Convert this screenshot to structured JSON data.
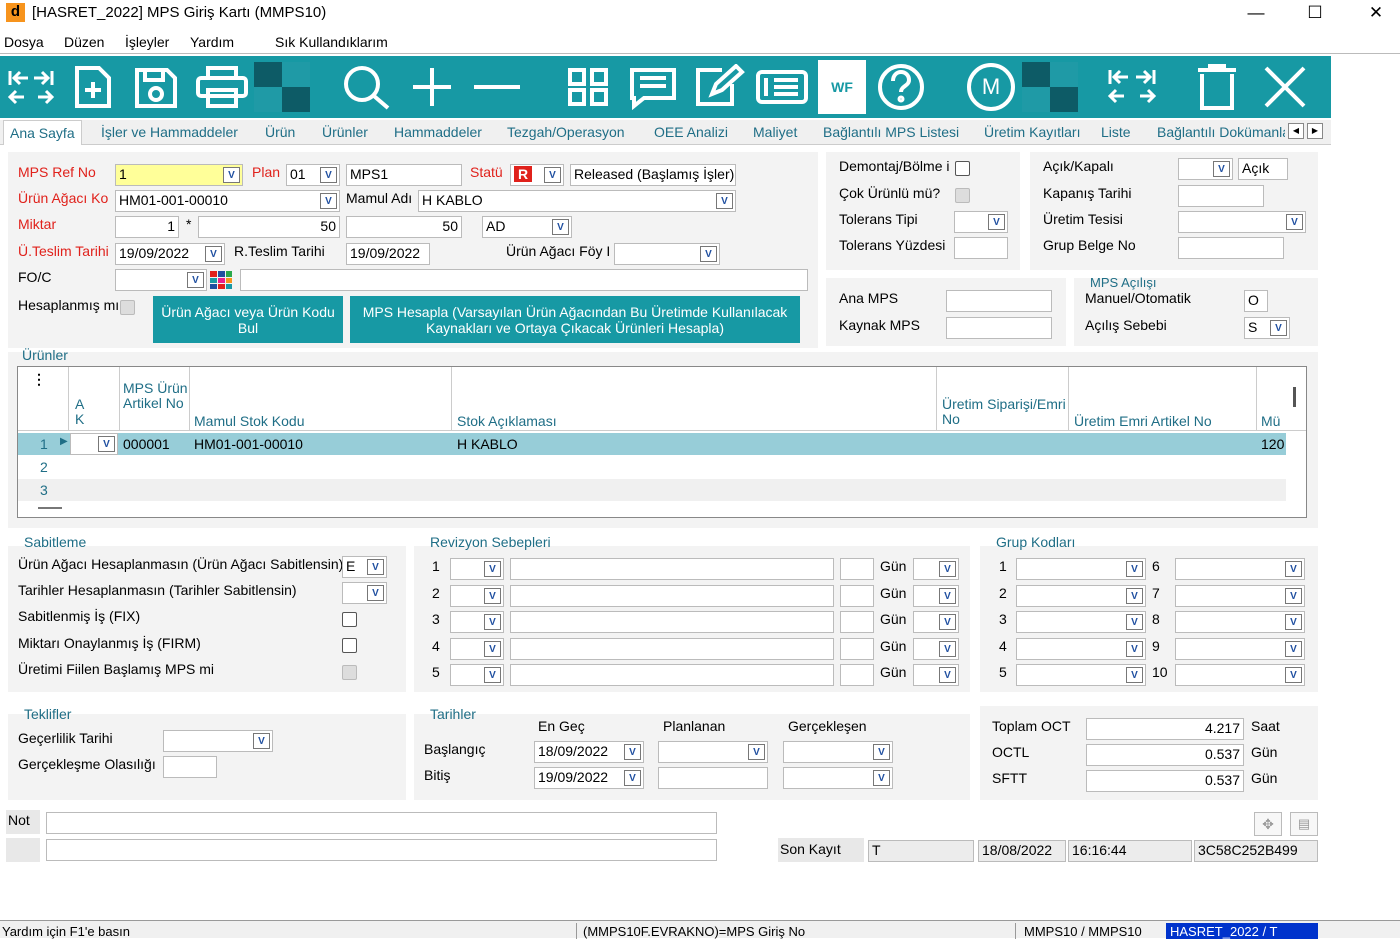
{
  "window": {
    "title": "[HASRET_2022] MPS Giriş Kartı (MMPS10)",
    "icon_letter": "d"
  },
  "menu": [
    "Dosya",
    "Düzen",
    "İşleyler",
    "Yardım",
    "Sık Kullandıklarım"
  ],
  "toolbar": {
    "wf": "WF",
    "m": "M"
  },
  "tabs": [
    "Ana Sayfa",
    "İşler ve Hammaddeler",
    "Ürün",
    "Ürünler",
    "Hammaddeler",
    "Tezgah/Operasyon",
    "OEE Analizi",
    "Maliyet",
    "Bağlantılı MPS Listesi",
    "Üretim Kayıtları",
    "Liste",
    "Bağlantılı Dokümanla"
  ],
  "header": {
    "mps_ref_label": "MPS Ref No",
    "mps_ref_value": "1",
    "plan_label": "Plan",
    "plan_value": "01",
    "plan_name": "MPS1",
    "statu_label": "Statü",
    "statu_code": "R",
    "statu_text": "Released (Başlamış İşler)",
    "urun_agaci_label": "Ürün Ağacı Ko",
    "urun_agaci_value": "HM01-001-00010",
    "mamul_adi_label": "Mamul Adı",
    "mamul_adi_value": "H KABLO",
    "miktar_label": "Miktar",
    "miktar_a": "1",
    "miktar_star": "*",
    "miktar_b": "50",
    "miktar_c": "50",
    "unit": "AD",
    "teslim_label": "Ü.Teslim Tarihi",
    "teslim_value": "19/09/2022",
    "rteslim_label": "R.Teslim Tarihi",
    "rteslim_value": "19/09/2022",
    "foy_label": "Ürün Ağacı Föy I",
    "fo_label": "FO/C",
    "hesap_label": "Hesaplanmış mı",
    "btn_find": "Ürün Ağacı veya Ürün Kodu Bul",
    "btn_calc": "MPS Hesapla (Varsayılan Ürün Ağacından Bu Üretimde Kullanılacak Kaynakları ve Ortaya Çıkacak Ürünleri Hesapla)"
  },
  "right": {
    "demontaj": "Demontaj/Bölme i",
    "cok_urunlu": "Çok Ürünlü mü?",
    "tolerans_tipi": "Tolerans Tipi",
    "tolerans_yuzdesi": "Tolerans Yüzdesi",
    "acik_kapali": "Açık/Kapalı",
    "acik_value": "Açık",
    "kapanis": "Kapanış Tarihi",
    "uretim_tesisi": "Üretim Tesisi",
    "grup_belge": "Grup Belge No",
    "ana_mps": "Ana MPS",
    "kaynak_mps": "Kaynak MPS",
    "mps_acilisi": "MPS Açılışı",
    "manuel": "Manuel/Otomatik",
    "manuel_value": "O",
    "acilis_sebebi": "Açılış Sebebi",
    "acilis_value": "S"
  },
  "urunler": {
    "title": "Ürünler",
    "columns": [
      "A K",
      "MPS Ürün Artikel No",
      "Mamul Stok Kodu",
      "Stok Açıklaması",
      "Üretim Siparişi/Emri No",
      "Üretim Emri Artikel No",
      "Mü"
    ],
    "rows": [
      {
        "n": "1",
        "artikel": "000001",
        "kod": "HM01-001-00010",
        "aciklama": "H KABLO",
        "mu": "120"
      },
      {
        "n": "2"
      },
      {
        "n": "3"
      }
    ]
  },
  "sabitleme": {
    "title": "Sabitleme",
    "l1": "Ürün Ağacı Hesaplanmasın (Ürün Ağacı Sabitlensin)",
    "l1v": "E",
    "l2": "Tarihler Hesaplanmasın (Tarihler Sabitlensin)",
    "l3": "Sabitlenmiş İş (FIX)",
    "l4": "Miktarı Onaylanmış İş (FIRM)",
    "l5": "Üretimi Fiilen Başlamış MPS mi"
  },
  "revizyon": {
    "title": "Revizyon Sebepleri",
    "nums": [
      "1",
      "2",
      "3",
      "4",
      "5"
    ],
    "gun": "Gün"
  },
  "grup": {
    "title": "Grup Kodları",
    "left": [
      "1",
      "2",
      "3",
      "4",
      "5"
    ],
    "right": [
      "6",
      "7",
      "8",
      "9",
      "10"
    ]
  },
  "teklifler": {
    "title": "Teklifler",
    "gecerlilik": "Geçerlilik Tarihi",
    "olasilik": "Gerçekleşme Olasılığı"
  },
  "tarihler": {
    "title": "Tarihler",
    "en_gec": "En Geç",
    "planlanan": "Planlanan",
    "gerceklesen": "Gerçekleşen",
    "baslangic": "Başlangıç",
    "bitis": "Bitiş",
    "bas_value": "18/09/2022",
    "bit_value": "19/09/2022"
  },
  "oct": {
    "toplam": "Toplam OCT",
    "toplam_v": "4.217",
    "saat": "Saat",
    "octl": "OCTL",
    "octl_v": "0.537",
    "gun": "Gün",
    "sftt": "SFTT",
    "sftt_v": "0.537"
  },
  "footer": {
    "not": "Not",
    "son_kayit": "Son Kayıt",
    "user": "T",
    "date": "18/08/2022",
    "time": "16:16:44",
    "hash": "3C58C252B499"
  },
  "status": {
    "help": "Yardım için F1'e basın",
    "field": "(MMPS10F.EVRAKNO)=MPS Giriş No",
    "form": "MMPS10 / MMPS10",
    "db": "HASRET_2022 / T"
  }
}
